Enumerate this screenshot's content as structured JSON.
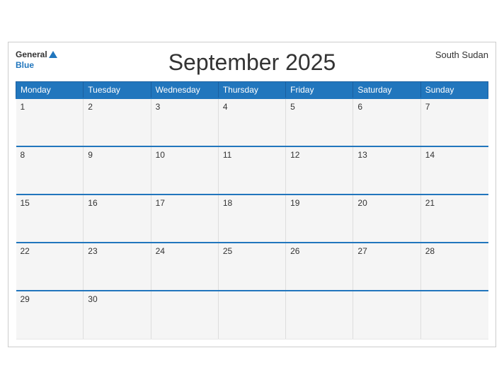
{
  "header": {
    "title": "September 2025",
    "country": "South Sudan",
    "logo_general": "General",
    "logo_blue": "Blue"
  },
  "days_of_week": [
    "Monday",
    "Tuesday",
    "Wednesday",
    "Thursday",
    "Friday",
    "Saturday",
    "Sunday"
  ],
  "weeks": [
    [
      {
        "day": "1",
        "empty": false
      },
      {
        "day": "2",
        "empty": false
      },
      {
        "day": "3",
        "empty": false
      },
      {
        "day": "4",
        "empty": false
      },
      {
        "day": "5",
        "empty": false
      },
      {
        "day": "6",
        "empty": false
      },
      {
        "day": "7",
        "empty": false
      }
    ],
    [
      {
        "day": "8",
        "empty": false
      },
      {
        "day": "9",
        "empty": false
      },
      {
        "day": "10",
        "empty": false
      },
      {
        "day": "11",
        "empty": false
      },
      {
        "day": "12",
        "empty": false
      },
      {
        "day": "13",
        "empty": false
      },
      {
        "day": "14",
        "empty": false
      }
    ],
    [
      {
        "day": "15",
        "empty": false
      },
      {
        "day": "16",
        "empty": false
      },
      {
        "day": "17",
        "empty": false
      },
      {
        "day": "18",
        "empty": false
      },
      {
        "day": "19",
        "empty": false
      },
      {
        "day": "20",
        "empty": false
      },
      {
        "day": "21",
        "empty": false
      }
    ],
    [
      {
        "day": "22",
        "empty": false
      },
      {
        "day": "23",
        "empty": false
      },
      {
        "day": "24",
        "empty": false
      },
      {
        "day": "25",
        "empty": false
      },
      {
        "day": "26",
        "empty": false
      },
      {
        "day": "27",
        "empty": false
      },
      {
        "day": "28",
        "empty": false
      }
    ],
    [
      {
        "day": "29",
        "empty": false
      },
      {
        "day": "30",
        "empty": false
      },
      {
        "day": "",
        "empty": true
      },
      {
        "day": "",
        "empty": true
      },
      {
        "day": "",
        "empty": true
      },
      {
        "day": "",
        "empty": true
      },
      {
        "day": "",
        "empty": true
      }
    ]
  ],
  "colors": {
    "header_bg": "#2176bd",
    "header_text": "#ffffff",
    "cell_bg": "#f5f5f5",
    "border_top": "#2176bd"
  }
}
